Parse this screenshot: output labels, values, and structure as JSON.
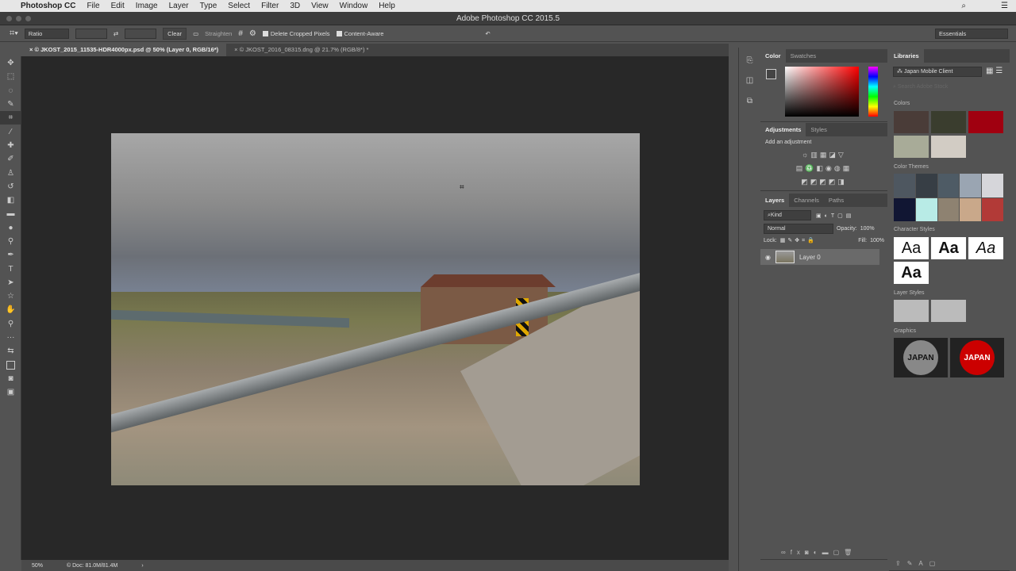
{
  "menubar": {
    "app": "Photoshop CC",
    "items": [
      "File",
      "Edit",
      "Image",
      "Layer",
      "Type",
      "Select",
      "Filter",
      "3D",
      "View",
      "Window",
      "Help"
    ]
  },
  "window_title": "Adobe Photoshop CC 2015.5",
  "options": {
    "ratio": "Ratio",
    "clear": "Clear",
    "straighten": "Straighten",
    "delete_cropped": "Delete Cropped Pixels",
    "content_aware": "Content-Aware",
    "workspace": "Essentials"
  },
  "tabs": [
    {
      "label": "© JKOST_2015_11535-HDR4000px.psd @ 50% (Layer 0, RGB/16*)"
    },
    {
      "label": "© JKOST_2016_08315.dng @ 21.7% (RGB/8*) *"
    }
  ],
  "status": {
    "zoom": "50%",
    "doc": "Doc: 81.0M/81.4M"
  },
  "color_panel": {
    "tabs": [
      "Color",
      "Swatches"
    ]
  },
  "adjustments": {
    "tabs": [
      "Adjustments",
      "Styles"
    ],
    "hint": "Add an adjustment"
  },
  "layers": {
    "tabs": [
      "Layers",
      "Channels",
      "Paths"
    ],
    "filter": "Kind",
    "blend": "Normal",
    "opacity_label": "Opacity:",
    "opacity": "100%",
    "lock_label": "Lock:",
    "fill_label": "Fill:",
    "fill": "100%",
    "layer_name": "Layer 0"
  },
  "libraries": {
    "title": "Libraries",
    "library": "Japan Mobile Client",
    "search_placeholder": "Search Adobe Stock",
    "colors_label": "Colors",
    "colors": [
      "#4a3c38",
      "#3a3d2e",
      "#a00010",
      "#a8ab98",
      "#d2ccc4"
    ],
    "themes_label": "Color Themes",
    "themes": [
      "#4e5760",
      "#373e45",
      "#4e5b65",
      "#9aa5b2",
      "#d6d6da",
      "#111633",
      "#b8ebe6",
      "#8e8271",
      "#c9a88a",
      "#b23a37"
    ],
    "char_label": "Character Styles",
    "char_sample": "Aa",
    "layer_styles_label": "Layer Styles",
    "graphics_label": "Graphics",
    "graphic_text": "JAPAN"
  }
}
